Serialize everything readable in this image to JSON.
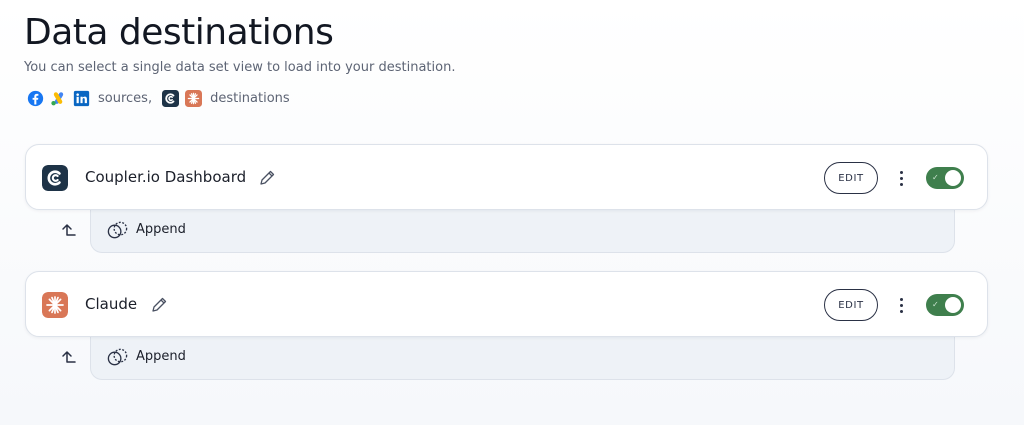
{
  "header": {
    "title": "Data destinations",
    "subtitle": "You can select a single data set view to load into your destination."
  },
  "legend": {
    "source_icons": [
      "facebook-icon",
      "google-ads-icon",
      "linkedin-icon"
    ],
    "sources_label": "sources,",
    "destination_icons": [
      "coupler-icon",
      "claude-icon"
    ],
    "destinations_label": "destinations"
  },
  "destinations": [
    {
      "name": "Coupler.io Dashboard",
      "icon": "coupler-icon",
      "edit_label": "EDIT",
      "enabled": true,
      "mode_label": "Append"
    },
    {
      "name": "Claude",
      "icon": "claude-icon",
      "edit_label": "EDIT",
      "enabled": true,
      "mode_label": "Append"
    }
  ],
  "colors": {
    "toggle_on": "#3f7f4d",
    "coupler_brand": "#1e3347",
    "claude_brand": "#d97757",
    "facebook": "#1877f2",
    "linkedin": "#0a66c2"
  }
}
